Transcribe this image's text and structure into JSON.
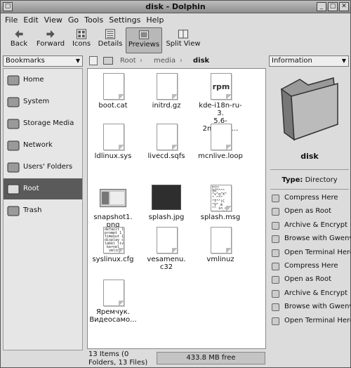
{
  "window": {
    "title": "disk - Dolphin"
  },
  "menu": [
    "File",
    "Edit",
    "View",
    "Go",
    "Tools",
    "Settings",
    "Help"
  ],
  "toolbar": {
    "back": "Back",
    "forward": "Forward",
    "icons": "Icons",
    "details": "Details",
    "previews": "Previews",
    "split": "Split View"
  },
  "sidebar_combo": "Bookmarks",
  "breadcrumb": {
    "root": "Root",
    "media": "media",
    "disk": "disk"
  },
  "info_combo": "Information",
  "places": [
    {
      "label": "Home",
      "icon": "home-icon"
    },
    {
      "label": "System",
      "icon": "computer-icon"
    },
    {
      "label": "Storage Media",
      "icon": "storage-icon"
    },
    {
      "label": "Network",
      "icon": "network-icon"
    },
    {
      "label": "Users' Folders",
      "icon": "users-folder-icon"
    },
    {
      "label": "Root",
      "icon": "root-folder-icon",
      "selected": true
    },
    {
      "label": "Trash",
      "icon": "trash-icon"
    }
  ],
  "files": [
    {
      "name": "boot.cat",
      "type": "doc"
    },
    {
      "name": "initrd.gz",
      "type": "doc"
    },
    {
      "name": "kde-i18n-ru-3.\n5.6-2mdv20...",
      "type": "rpm"
    },
    {
      "name": "ldlinux.sys",
      "type": "doc"
    },
    {
      "name": "livecd.sqfs",
      "type": "doc"
    },
    {
      "name": "mcnlive.loop",
      "type": "doc"
    },
    {
      "name": "snapshot1.\npng",
      "type": "image"
    },
    {
      "name": "splash.jpg",
      "type": "dark"
    },
    {
      "name": "splash.msg",
      "type": "doc"
    },
    {
      "name": "syslinux.cfg",
      "type": "text"
    },
    {
      "name": "vesamenu.\nc32",
      "type": "doc"
    },
    {
      "name": "vmlinuz",
      "type": "doc"
    },
    {
      "name": "Яремчук.\nВидеосамо...",
      "type": "doc"
    }
  ],
  "thumb_text": {
    "rpm": "rpm",
    "splash_msg": "\u0007\u000f\n9d^^^^\n^v^q^X^\n^_^^^\n^T^^(C\n^V^ m\n^^ in_cd",
    "syslinux": "default li\nprompt 1\ntimeout 15\ndisplay cp\nlabel live\n kernel\n  vmlinu\n append"
  },
  "info": {
    "name": "disk",
    "type_label": "Type:",
    "type_value": "Directory"
  },
  "actions": [
    "Compress Here",
    "Open as Root",
    "Archive & Encrypt F",
    "Browse with Gwenv",
    "Open Terminal Here",
    "Compress Here",
    "Open as Root",
    "Archive & Encrypt F",
    "Browse with Gwenv",
    "Open Terminal Here"
  ],
  "status": {
    "items": "13 Items (0\nFolders, 13 Files)",
    "free": "433.8 MB free"
  }
}
